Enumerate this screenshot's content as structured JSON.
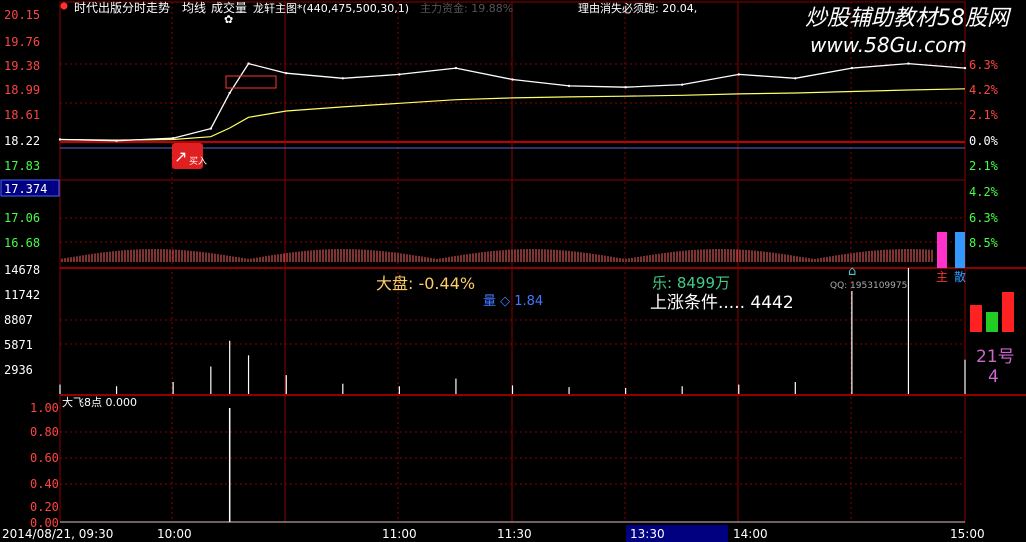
{
  "header": {
    "title": "时代出版分时走势",
    "labels": [
      "均线",
      "成交量",
      "龙轩主图*(440,475,500,30,1)"
    ],
    "main_fund": "主力资金: 19.88%",
    "reason": "理由消失必须跑: 20.04,"
  },
  "watermark": {
    "line1": "炒股辅助教材58股网",
    "line2": "www.58Gu.com"
  },
  "price_panel": {
    "y_ticks": [
      "20.15",
      "19.76",
      "19.38",
      "18.99",
      "18.61",
      "18.22",
      "17.83",
      "17.374",
      "17.06",
      "16.68"
    ],
    "current_price": "17.374",
    "pct_ticks": [
      "6.3%",
      "4.2%",
      "2.1%",
      "0.0%",
      "2.1%",
      "4.2%",
      "6.3%",
      "8.5%"
    ],
    "buy_signal": "买入",
    "side_labels": [
      "主",
      "散"
    ]
  },
  "volume_panel": {
    "y_ticks": [
      "14678",
      "11742",
      "8807",
      "5871",
      "2936"
    ],
    "market_text": "大盘: -0.44%",
    "liang_text": "量 ◇ 1.84",
    "money_text": "乐: 8499万",
    "condition_text": "上涨条件..... 4442",
    "qq_text": "QQ: 1953109975",
    "badge_num": "21号",
    "badge_sub": "4"
  },
  "indicator_panel": {
    "label": "大飞8点 0.000",
    "y_ticks": [
      "1.00",
      "0.80",
      "0.60",
      "0.40",
      "0.20",
      "0.00"
    ]
  },
  "time_axis": {
    "date_label": "2014/08/21, 09:30",
    "ticks": [
      "10:00",
      "11:00",
      "11:30",
      "13:30",
      "14:00",
      "15:00"
    ]
  },
  "colors": {
    "grid": "#8b0000",
    "price_line": "#ffffff",
    "avg_line": "#ffff66",
    "axis_red": "#ff4444",
    "axis_green": "#44ff44"
  },
  "chart_data": {
    "type": "line",
    "title": "时代出版分时走势",
    "date": "2014/08/21",
    "prev_close": 18.22,
    "ylim": [
      16.68,
      20.15
    ],
    "x_times": [
      "09:30",
      "09:45",
      "10:00",
      "10:10",
      "10:15",
      "10:20",
      "10:30",
      "10:45",
      "11:00",
      "11:15",
      "11:30",
      "13:15",
      "13:30",
      "13:45",
      "14:00",
      "14:15",
      "14:30",
      "14:45",
      "15:00"
    ],
    "series": [
      {
        "values": [
          18.26,
          18.24,
          18.28,
          18.43,
          18.99,
          19.45,
          19.3,
          19.22,
          19.28,
          19.38,
          19.2,
          19.1,
          19.08,
          19.12,
          19.28,
          19.22,
          19.38,
          19.45,
          19.38
        ]
      }
    ],
    "volume": [
      1100,
      900,
      1400,
      3200,
      6200,
      4500,
      2200,
      1200,
      900,
      1800,
      1000,
      800,
      700,
      900,
      1100,
      1400,
      12000,
      14678,
      4000
    ],
    "indicator": {
      "name": "大飞8点",
      "spike_time": "10:15",
      "spike_value": 1.0
    }
  }
}
